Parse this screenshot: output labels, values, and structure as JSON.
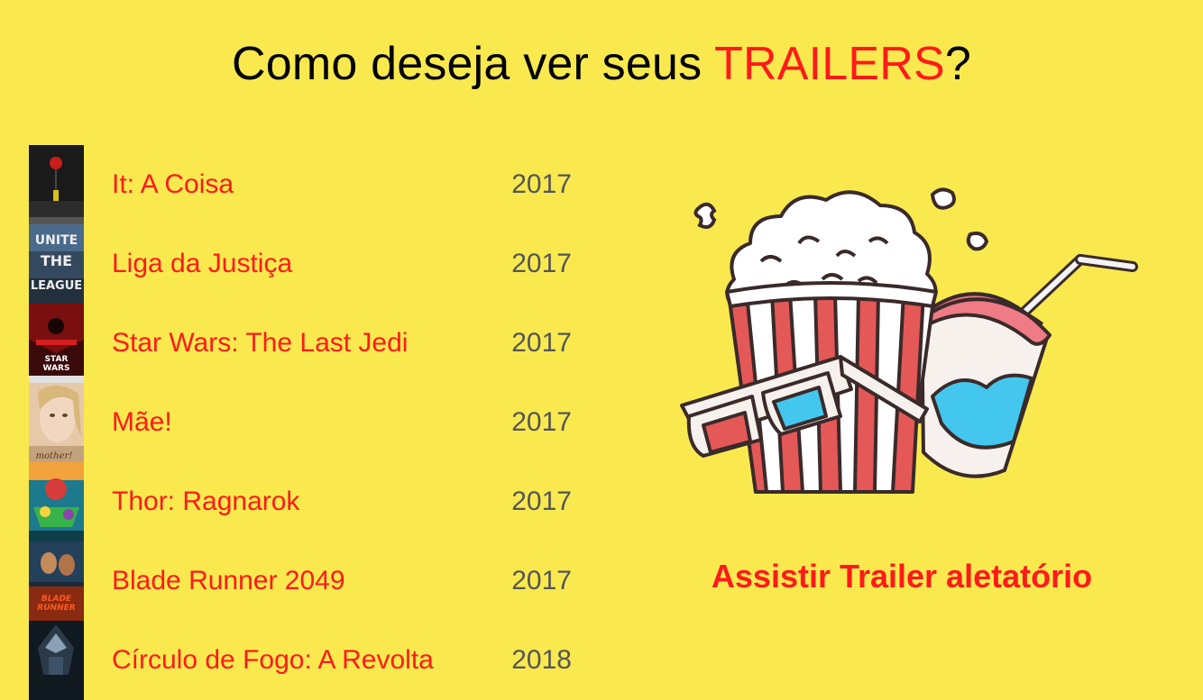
{
  "header": {
    "title_prefix": "Como deseja ver seus ",
    "title_accent": "TRAILERS",
    "title_suffix": "?"
  },
  "movies": [
    {
      "title": "It: A Coisa",
      "year": "2017"
    },
    {
      "title": "Liga da Justiça",
      "year": "2017"
    },
    {
      "title": "Star Wars: The Last Jedi",
      "year": "2017"
    },
    {
      "title": "Mãe!",
      "year": "2017"
    },
    {
      "title": "Thor: Ragnarok",
      "year": "2017"
    },
    {
      "title": "Blade Runner 2049",
      "year": "2017"
    },
    {
      "title": "Círculo de Fogo: A Revolta",
      "year": "2018"
    }
  ],
  "poster_texts": {
    "justice_league": [
      "UNITE",
      "THE",
      "LEAGUE"
    ],
    "star_wars": [
      "STAR",
      "WARS"
    ],
    "mae": "mother!",
    "blade_runner": [
      "BLADE",
      "RUNNER"
    ]
  },
  "actions": {
    "random_trailer": "Assistir Trailer aletatório"
  },
  "colors": {
    "background": "#f9e94f",
    "accent": "#ff1a1a",
    "year_text": "#555555"
  },
  "illustration": "popcorn-soda-3d-glasses"
}
